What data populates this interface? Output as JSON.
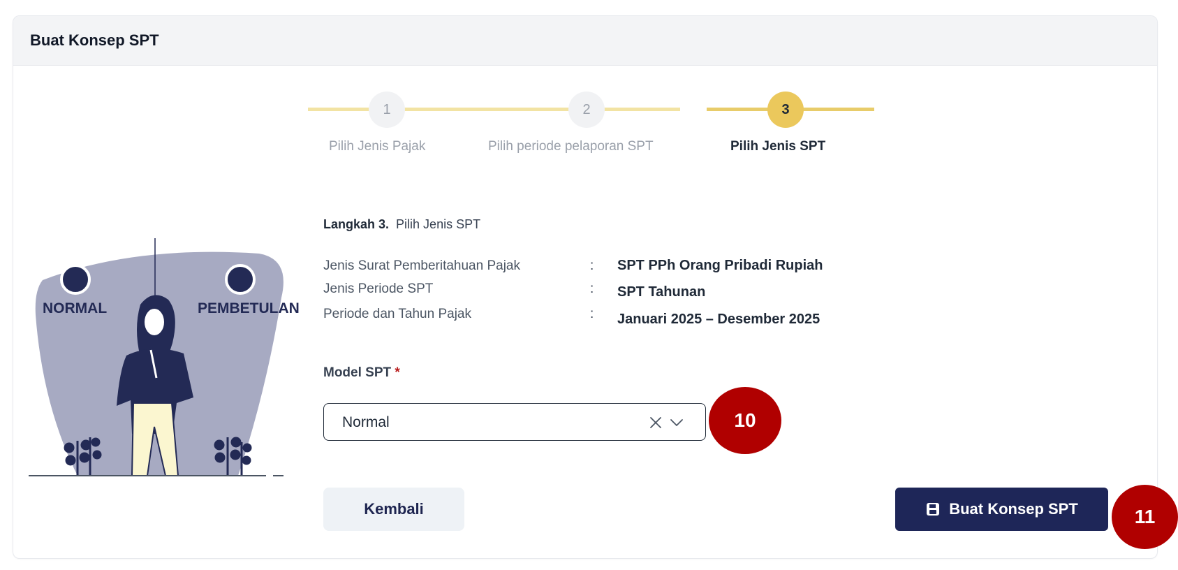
{
  "card": {
    "title": "Buat Konsep SPT"
  },
  "stepper": {
    "steps": [
      {
        "number": "1",
        "label": "Pilih Jenis Pajak",
        "state": "done"
      },
      {
        "number": "2",
        "label": "Pilih periode pelaporan SPT",
        "state": "done"
      },
      {
        "number": "3",
        "label": "Pilih Jenis SPT",
        "state": "active"
      }
    ]
  },
  "step_heading": {
    "bold": "Langkah 3.",
    "text": "Pilih Jenis SPT"
  },
  "info": [
    {
      "label": "Jenis Surat Pemberitahuan Pajak",
      "colon": ":",
      "value": "SPT PPh Orang Pribadi Rupiah"
    },
    {
      "label": "Jenis Periode SPT",
      "colon": ":",
      "value": "SPT Tahunan"
    },
    {
      "label": "Periode dan Tahun Pajak",
      "colon": ":",
      "value": "Januari 2025 – Desember 2025"
    }
  ],
  "model_spt": {
    "label": "Model SPT",
    "required_mark": "*",
    "selected": "Normal"
  },
  "illustration": {
    "left_text": "NORMAL",
    "right_text": "PEMBETULAN"
  },
  "buttons": {
    "back": "Kembali",
    "create": "Buat Konsep SPT"
  },
  "callouts": {
    "select": "10",
    "create": "11"
  },
  "colors": {
    "primary": "#1e2658",
    "accent": "#ebc85c",
    "callout": "#b00000"
  }
}
